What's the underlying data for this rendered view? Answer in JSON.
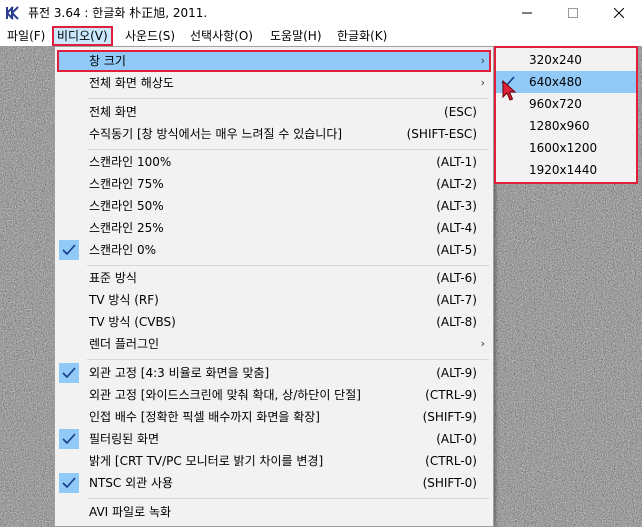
{
  "window": {
    "title": "퓨전 3.64 : 한글화 朴正旭, 2011.",
    "icon": "app-logo-icon",
    "controls": [
      "minimize-icon",
      "maximize-icon",
      "close-icon"
    ]
  },
  "menubar": {
    "items": [
      {
        "label": "파일(F)"
      },
      {
        "label": "비디오(V)",
        "active": true
      },
      {
        "label": "사운드(S)"
      },
      {
        "label": "선택사항(O)"
      },
      {
        "label": "도움말(H)"
      },
      {
        "label": "한글화(K)"
      }
    ]
  },
  "video_menu": {
    "items": [
      {
        "label": "창 크기",
        "submenu": true,
        "highlighted": true
      },
      {
        "label": "전체 화면 해상도",
        "submenu": true
      },
      {
        "label": "전체 화면",
        "shortcut": "(ESC)"
      },
      {
        "label": "수직동기 [창 방식에서는 매우 느려질 수 있습니다]",
        "shortcut": "(SHIFT-ESC)"
      },
      {
        "label": "스캔라인 100%",
        "shortcut": "(ALT-1)"
      },
      {
        "label": "스캔라인 75%",
        "shortcut": "(ALT-2)"
      },
      {
        "label": "스캔라인 50%",
        "shortcut": "(ALT-3)"
      },
      {
        "label": "스캔라인 25%",
        "shortcut": "(ALT-4)"
      },
      {
        "label": "스캔라인 0%",
        "shortcut": "(ALT-5)",
        "checked": true
      },
      {
        "label": "표준 방식",
        "shortcut": "(ALT-6)"
      },
      {
        "label": "TV 방식 (RF)",
        "shortcut": "(ALT-7)"
      },
      {
        "label": "TV 방식 (CVBS)",
        "shortcut": "(ALT-8)"
      },
      {
        "label": "렌더 플러그인",
        "submenu": true
      },
      {
        "label": "외관 고정 [4:3 비율로 화면을 맞춤]",
        "shortcut": "(ALT-9)",
        "checked": true
      },
      {
        "label": "외관 고정 [와이드스크린에 맞춰 확대, 상/하단이 단절]",
        "shortcut": "(CTRL-9)"
      },
      {
        "label": "인접 배수 [정확한 픽셀 배수까지 화면을 확장]",
        "shortcut": "(SHIFT-9)"
      },
      {
        "label": "필터링된 화면",
        "shortcut": "(ALT-0)",
        "checked": true
      },
      {
        "label": "밝게 [CRT TV/PC 모니터로 밝기 차이를 변경]",
        "shortcut": "(CTRL-0)"
      },
      {
        "label": "NTSC 외관 사용",
        "shortcut": "(SHIFT-0)",
        "checked": true
      },
      {
        "label": "AVI 파일로 녹화"
      }
    ]
  },
  "window_size_submenu": {
    "items": [
      {
        "label": "320x240"
      },
      {
        "label": "640x480",
        "checked": true,
        "highlighted": true
      },
      {
        "label": "960x720"
      },
      {
        "label": "1280x960"
      },
      {
        "label": "1600x1200"
      },
      {
        "label": "1920x1440"
      }
    ]
  },
  "colors": {
    "highlight": "#91c9f7",
    "menubar_active": "#cce8ff",
    "annotation_border": "#e0203a",
    "menu_background": "#f2f2f2",
    "cursor": "#e0203a"
  }
}
